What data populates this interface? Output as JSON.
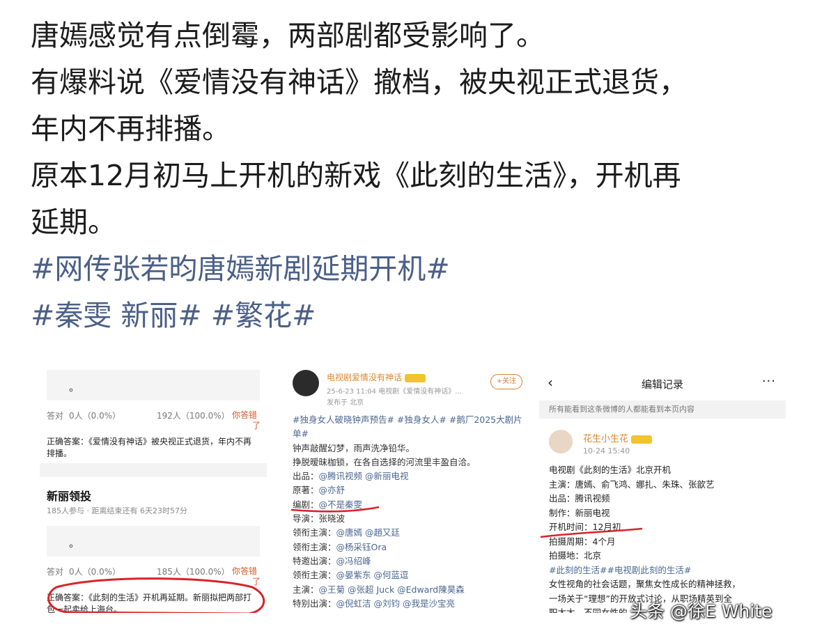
{
  "post": {
    "lines": [
      "唐嫣感觉有点倒霉，两部剧都受影响了。",
      "有爆料说《爱情没有神话》撤档，被央视正式退货，",
      "年内不再排播。",
      "原本12月初马上开机的新戏《此刻的生活》，开机再",
      "延期。"
    ],
    "hashtags": [
      "#网传张若昀唐嫣新剧延期开机#",
      "#秦雯 新丽# #繁花#"
    ]
  },
  "quiz_panel": {
    "q1": {
      "option_text": "。",
      "correct_label": "答对",
      "correct_count": "0人（0.0%）",
      "total": "192人（100.0%）",
      "wrong_line1": "你答错",
      "wrong_line2": "了",
      "answer": "正确答案：《爱情没有神话》被央视正式退货，年内不再排播。"
    },
    "q2": {
      "title": "新丽领投",
      "meta": "185人参与 · 距离结束还有 6天23时57分",
      "option_text": "。",
      "correct_label": "答对",
      "correct_count": "0人（0.0%）",
      "total": "185人（100.0%）",
      "wrong_line1": "你答错",
      "wrong_line2": "了",
      "answer": "正确答案：《此刻的生活》开机再延期。新丽拟把两部打包一起卖给上海台。"
    }
  },
  "weibo_post": {
    "account": "电视剧爱情没有神话",
    "meta_line1": "25-6-23 11:04  电视剧《爱情没有神话》...",
    "meta_line2": "发布于 北京",
    "follow_label": "+关注",
    "lines": [
      {
        "text": "#独身女人破晓钟声预告# #独身女人# #鹅厂2025大剧片单#",
        "kind": "tag"
      },
      {
        "text": "钟声敲醒幻梦，雨声洗净铅华。",
        "kind": "text"
      },
      {
        "text": "挣脱暧昧枷锁，在各自选择的河流里丰盈自洽。",
        "kind": "text"
      },
      {
        "label": "出品：",
        "value": "@腾讯视频 @新丽电视"
      },
      {
        "label": "原著：",
        "value": "@亦舒"
      },
      {
        "label": "编剧：",
        "value": "@不是秦雯"
      },
      {
        "label": "导演：",
        "value": "张晓波",
        "plain": true
      },
      {
        "label": "领衔主演：",
        "value": "@唐嫣 @趙又廷"
      },
      {
        "label": "领衔主演：",
        "value": "@杨采钰Ora"
      },
      {
        "label": "特邀出演：",
        "value": "@冯绍峰"
      },
      {
        "label": "领衔主演：",
        "value": "@晏紫东 @何蓝逗"
      },
      {
        "label": "主演：",
        "value": "@王菊 @张超 Juck @Edward陳昊森"
      },
      {
        "label": "特别出演：",
        "value": "@倪虹洁 @刘钧 @我是沙宝亮"
      }
    ]
  },
  "edit_record": {
    "back_icon": "‹",
    "title": "编辑记录",
    "more_icon": "···",
    "notice": "所有能看到这条微博的人都能看到本页内容",
    "user": "花生小生花",
    "time": "10-24 15:40",
    "lines": [
      {
        "text": "电视剧《此刻的生活》北京开机",
        "kind": "text"
      },
      {
        "text": "主演：唐嫣、俞飞鸿、娜扎、朱珠、张歆艺",
        "kind": "text"
      },
      {
        "text": "出品：腾讯视频",
        "kind": "text"
      },
      {
        "text": "制作：新丽电视",
        "kind": "text"
      },
      {
        "text": "开机时间：12月初",
        "kind": "text"
      },
      {
        "text": "拍摄周期：4个月",
        "kind": "text"
      },
      {
        "text": "拍摄地：北京",
        "kind": "text"
      },
      {
        "text": "#此刻的生活##电视剧此刻的生活#",
        "kind": "tag"
      },
      {
        "text": "女性视角的社会话题，聚焦女性成长的精神拯救，",
        "kind": "text"
      },
      {
        "text": "一场关于“理想”的开放式讨论，从职场精英到全",
        "kind": "text"
      },
      {
        "text": "职太太，不同女性的",
        "kind": "text"
      }
    ]
  },
  "watermark": "头条 @徐E White",
  "colors": {
    "hashtag": "#4b5f87",
    "account_orange": "#e0862c",
    "wrong_red": "#d9582b",
    "annotation_red": "#d8232a"
  }
}
